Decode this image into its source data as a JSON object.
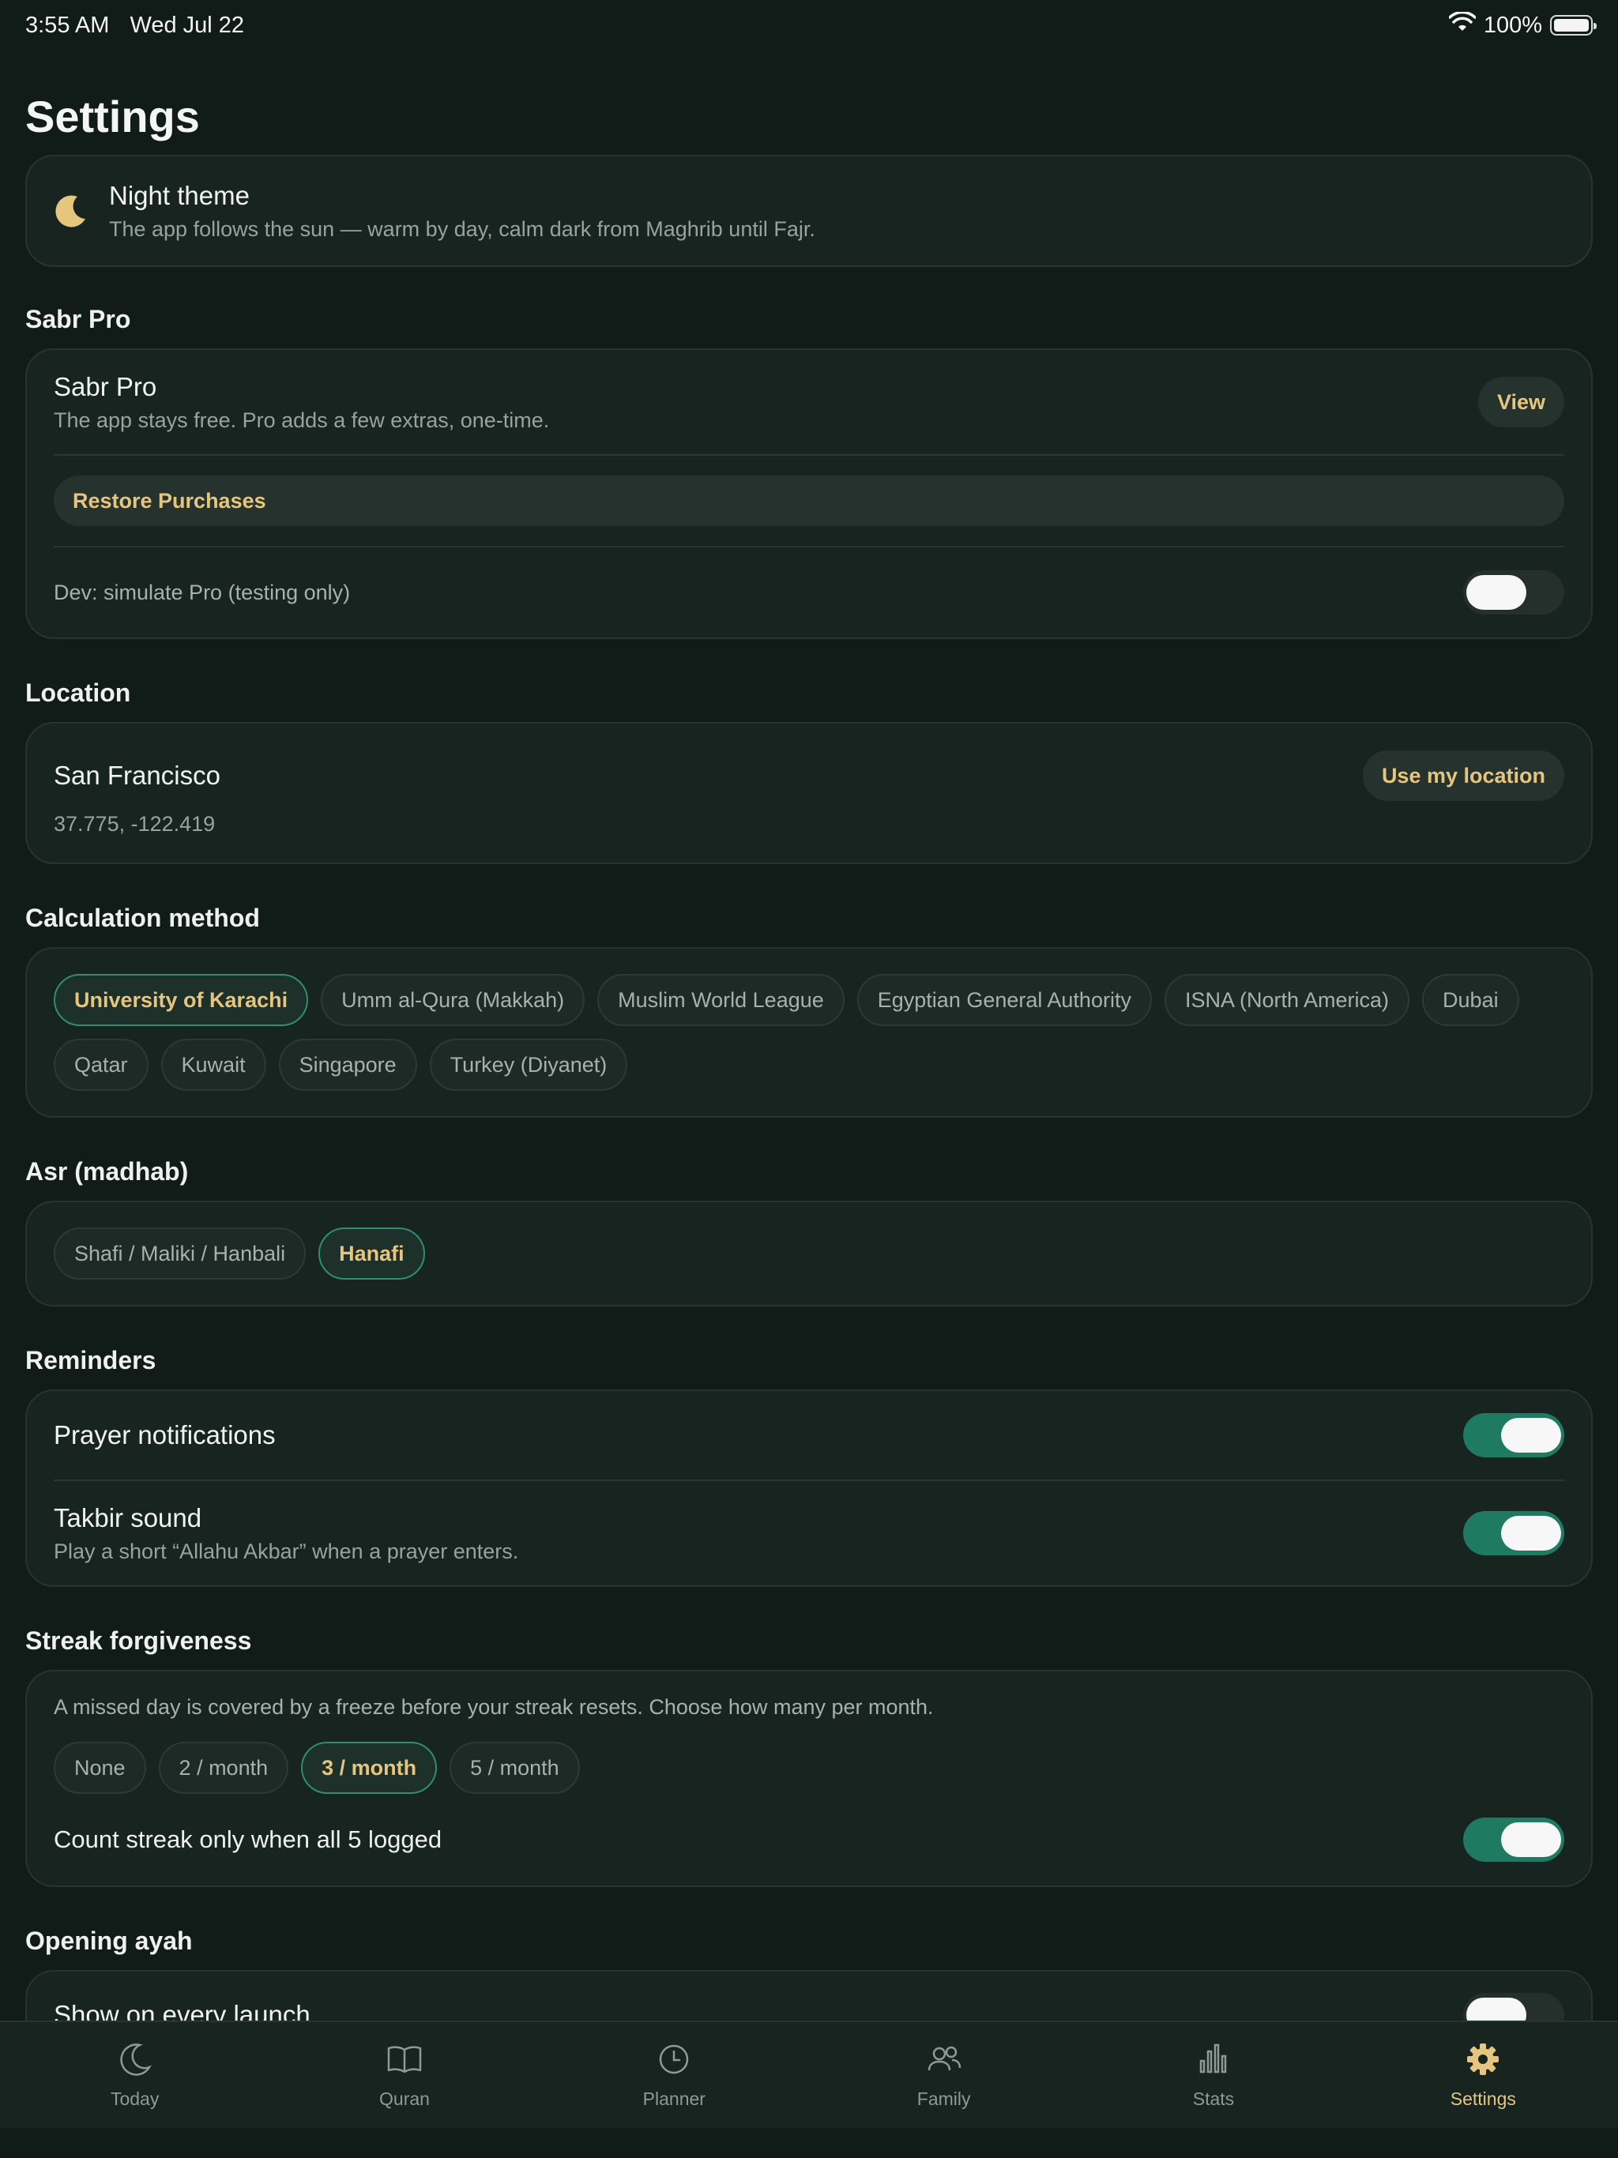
{
  "status_bar": {
    "time": "3:55 AM",
    "date": "Wed Jul 22",
    "battery": "100%"
  },
  "page_title": "Settings",
  "night_theme": {
    "title": "Night theme",
    "subtitle": "The app follows the sun — warm by day, calm dark from Maghrib until Fajr."
  },
  "sabr_pro": {
    "section": "Sabr Pro",
    "title": "Sabr Pro",
    "subtitle": "The app stays free. Pro adds a few extras, one-time.",
    "view_label": "View",
    "restore_label": "Restore Purchases",
    "dev_label": "Dev: simulate Pro (testing only)",
    "dev_on": false
  },
  "location": {
    "section": "Location",
    "city": "San Francisco",
    "coords": "37.775, -122.419",
    "use_label": "Use my location"
  },
  "calculation": {
    "section": "Calculation method",
    "options": [
      "University of Karachi",
      "Umm al-Qura (Makkah)",
      "Muslim World League",
      "Egyptian General Authority",
      "ISNA (North America)",
      "Dubai",
      "Qatar",
      "Kuwait",
      "Singapore",
      "Turkey (Diyanet)"
    ],
    "selected": "University of Karachi"
  },
  "asr": {
    "section": "Asr (madhab)",
    "options": [
      "Shafi / Maliki / Hanbali",
      "Hanafi"
    ],
    "selected": "Hanafi"
  },
  "reminders": {
    "section": "Reminders",
    "prayer_label": "Prayer notifications",
    "prayer_on": true,
    "takbir_label": "Takbir sound",
    "takbir_sub": "Play a short “Allahu Akbar” when a prayer enters.",
    "takbir_on": true
  },
  "streak": {
    "section": "Streak forgiveness",
    "description": "A missed day is covered by a freeze before your streak resets. Choose how many per month.",
    "options": [
      "None",
      "2 / month",
      "3 / month",
      "5 / month"
    ],
    "selected": "3 / month",
    "all5_label": "Count streak only when all 5 logged",
    "all5_on": true
  },
  "opening_ayah": {
    "section": "Opening ayah",
    "launch_label": "Show on every launch",
    "launch_on": false
  },
  "tabs": [
    {
      "label": "Today",
      "icon": "moon-icon"
    },
    {
      "label": "Quran",
      "icon": "book-icon"
    },
    {
      "label": "Planner",
      "icon": "clock-icon"
    },
    {
      "label": "Family",
      "icon": "people-icon"
    },
    {
      "label": "Stats",
      "icon": "bar-chart-icon"
    },
    {
      "label": "Settings",
      "icon": "gear-icon"
    }
  ],
  "active_tab": "Settings",
  "colors": {
    "accent": "#e6c57f",
    "toggle_on": "#1f7a62",
    "background": "#111b18",
    "card": "#182420"
  }
}
